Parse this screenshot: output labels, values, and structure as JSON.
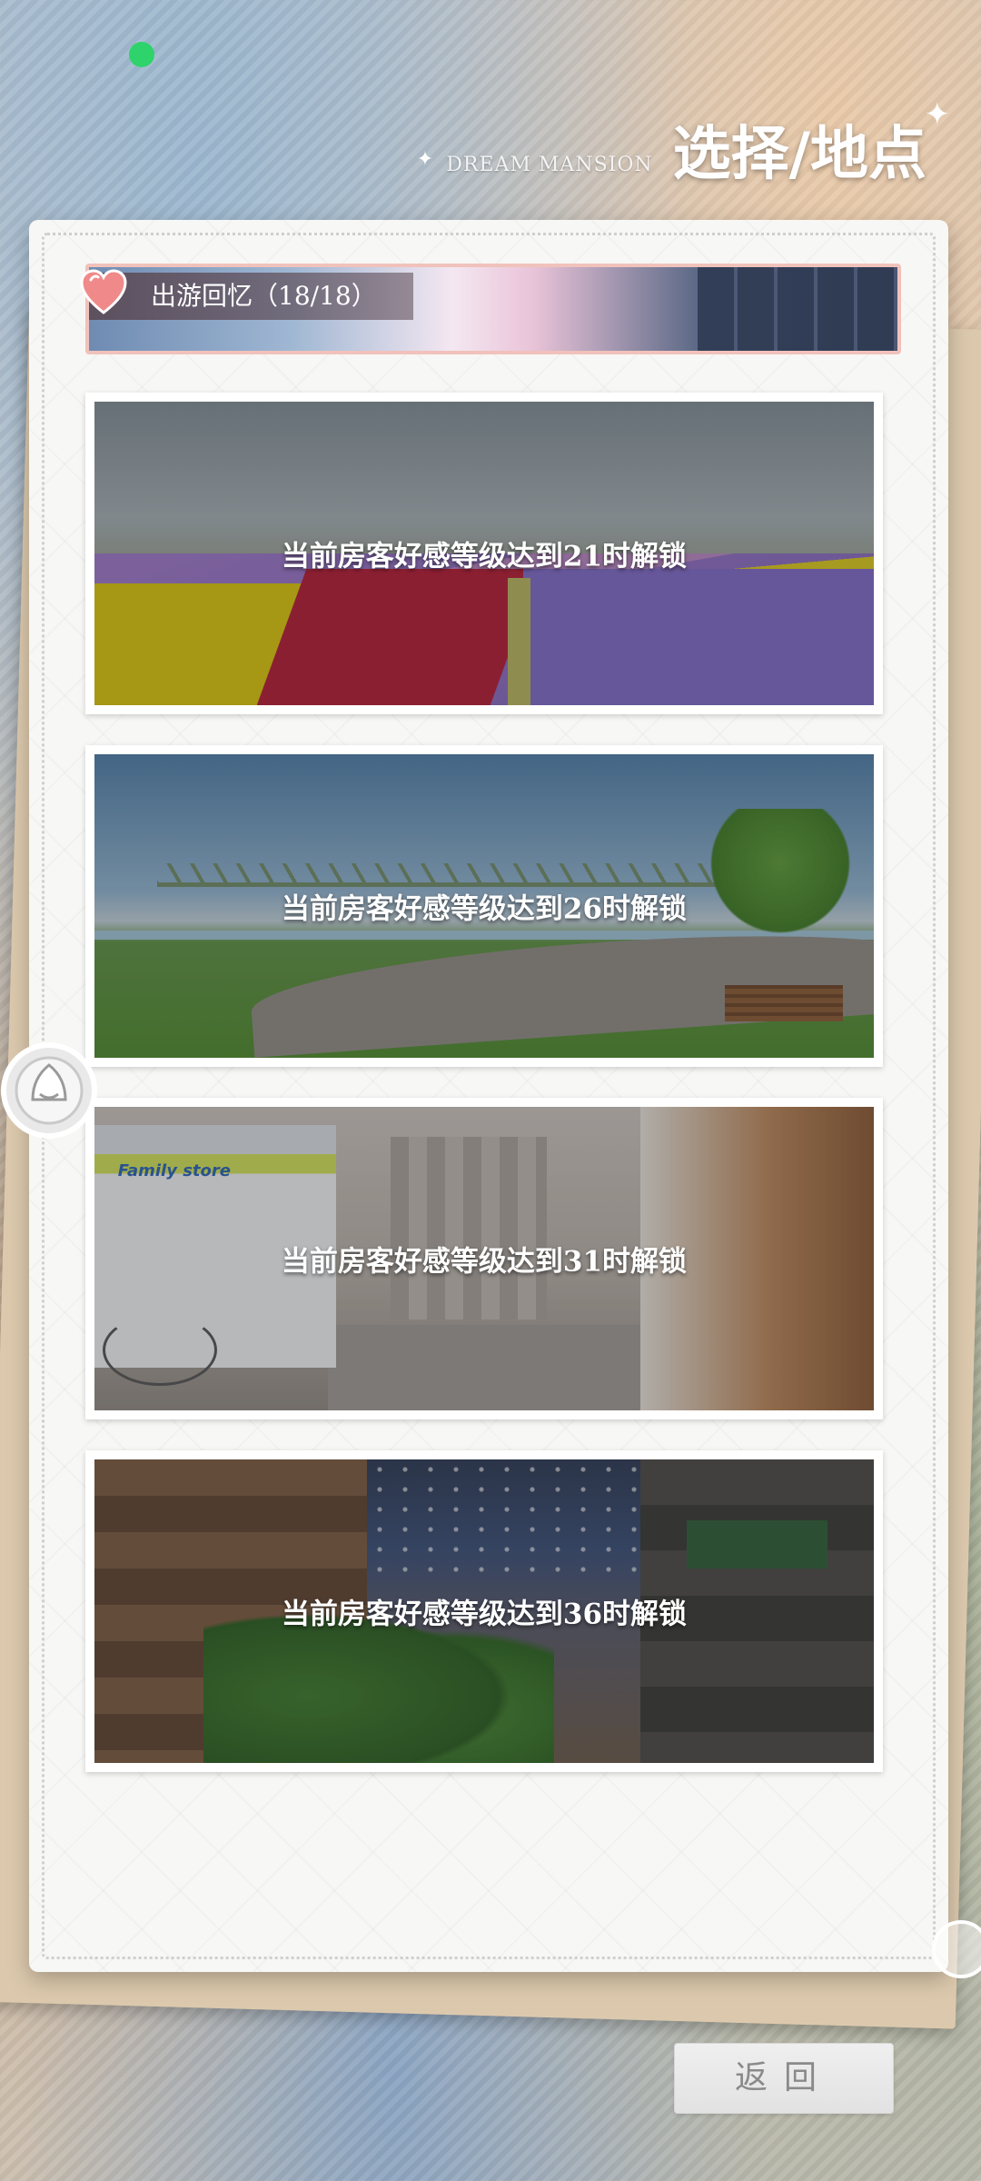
{
  "header": {
    "subtitle": "DREAM MANSION",
    "title": "选择/地点"
  },
  "category": {
    "label": "出游回忆（18/18）",
    "icon": "heart-icon"
  },
  "scenes": [
    {
      "lock_text": "当前房客好感等级达到21时解锁",
      "scene": "flower-field"
    },
    {
      "lock_text": "当前房客好感等级达到26时解锁",
      "scene": "riverside-park"
    },
    {
      "lock_text": "当前房客好感等级达到31时解锁",
      "scene": "shopping-street"
    },
    {
      "lock_text": "当前房客好感等级达到36时解锁",
      "scene": "covered-arcade"
    }
  ],
  "back_button": {
    "label": "返回"
  },
  "colors": {
    "status_dot": "#2fd36b",
    "banner_border": "#f0c2bb",
    "card_bg": "#f7f7f5"
  }
}
